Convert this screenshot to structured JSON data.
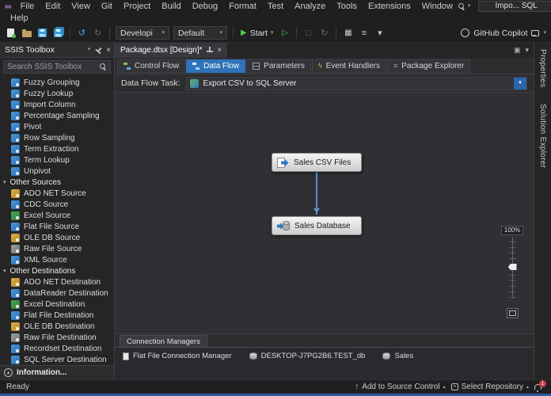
{
  "window": {
    "title": "Impo... SQL"
  },
  "menubar": {
    "items": [
      "File",
      "Edit",
      "View",
      "Git",
      "Project",
      "Build",
      "Debug",
      "Format",
      "Test",
      "Analyze",
      "Tools",
      "Extensions",
      "Window"
    ],
    "overflow": "Help"
  },
  "toolbar": {
    "config": "Developi",
    "platform": "Default",
    "start": "Start",
    "copilot": "GitHub Copilot"
  },
  "toolbox": {
    "title": "SSIS Toolbox",
    "search_placeholder": "Search SSIS Toolbox",
    "items_top": [
      "Fuzzy Grouping",
      "Fuzzy Lookup",
      "Import Column",
      "Percentage Sampling",
      "Pivot",
      "Row Sampling",
      "Term Extraction",
      "Term Lookup",
      "Unpivot"
    ],
    "sections": [
      {
        "title": "Other Sources",
        "items": [
          "ADO NET Source",
          "CDC Source",
          "Excel Source",
          "Flat File Source",
          "OLE DB Source",
          "Raw File Source",
          "XML Source"
        ]
      },
      {
        "title": "Other Destinations",
        "items": [
          "ADO NET Destination",
          "DataReader Destination",
          "Excel Destination",
          "Flat File Destination",
          "OLE DB Destination",
          "Raw File Destination",
          "Recordset Destination",
          "SQL Server Destination"
        ]
      }
    ],
    "footer": "Information..."
  },
  "editor": {
    "tab": "Package.dtsx [Design]*",
    "designer_tabs": [
      "Control Flow",
      "Data Flow",
      "Parameters",
      "Event Handlers",
      "Package Explorer"
    ],
    "selected_tab": "Data Flow",
    "task_label": "Data Flow Task:",
    "task_value": "Export CSV to SQL Server",
    "nodes": [
      {
        "label": "Sales CSV Files"
      },
      {
        "label": "Sales Database"
      }
    ],
    "zoom": "100%"
  },
  "connection_managers": {
    "tab": "Connection Managers",
    "items": [
      "Flat File Connection Manager",
      "DESKTOP-J7PG2B6.TEST_db",
      "Sales"
    ]
  },
  "side_tabs": [
    "Properties",
    "Solution Explorer"
  ],
  "statusbar": {
    "ready": "Ready",
    "source_control": "Add to Source Control",
    "repository": "Select Repository",
    "badge": "1"
  },
  "icons": [
    "vs-logo-icon",
    "search-icon",
    "minimize-icon",
    "maximize-icon",
    "close-icon",
    "new-file-icon",
    "open-folder-icon",
    "save-icon",
    "save-all-icon",
    "undo-icon",
    "redo-icon",
    "start-play-icon",
    "hollow-play-icon",
    "grid-icon",
    "list-icon",
    "copilot-icon",
    "chat-icon",
    "pin-icon",
    "chevron-down-icon",
    "source-node-icon",
    "destination-node-icon",
    "zoom-fit-icon",
    "bell-icon",
    "repo-icon",
    "up-arrow-icon"
  ]
}
